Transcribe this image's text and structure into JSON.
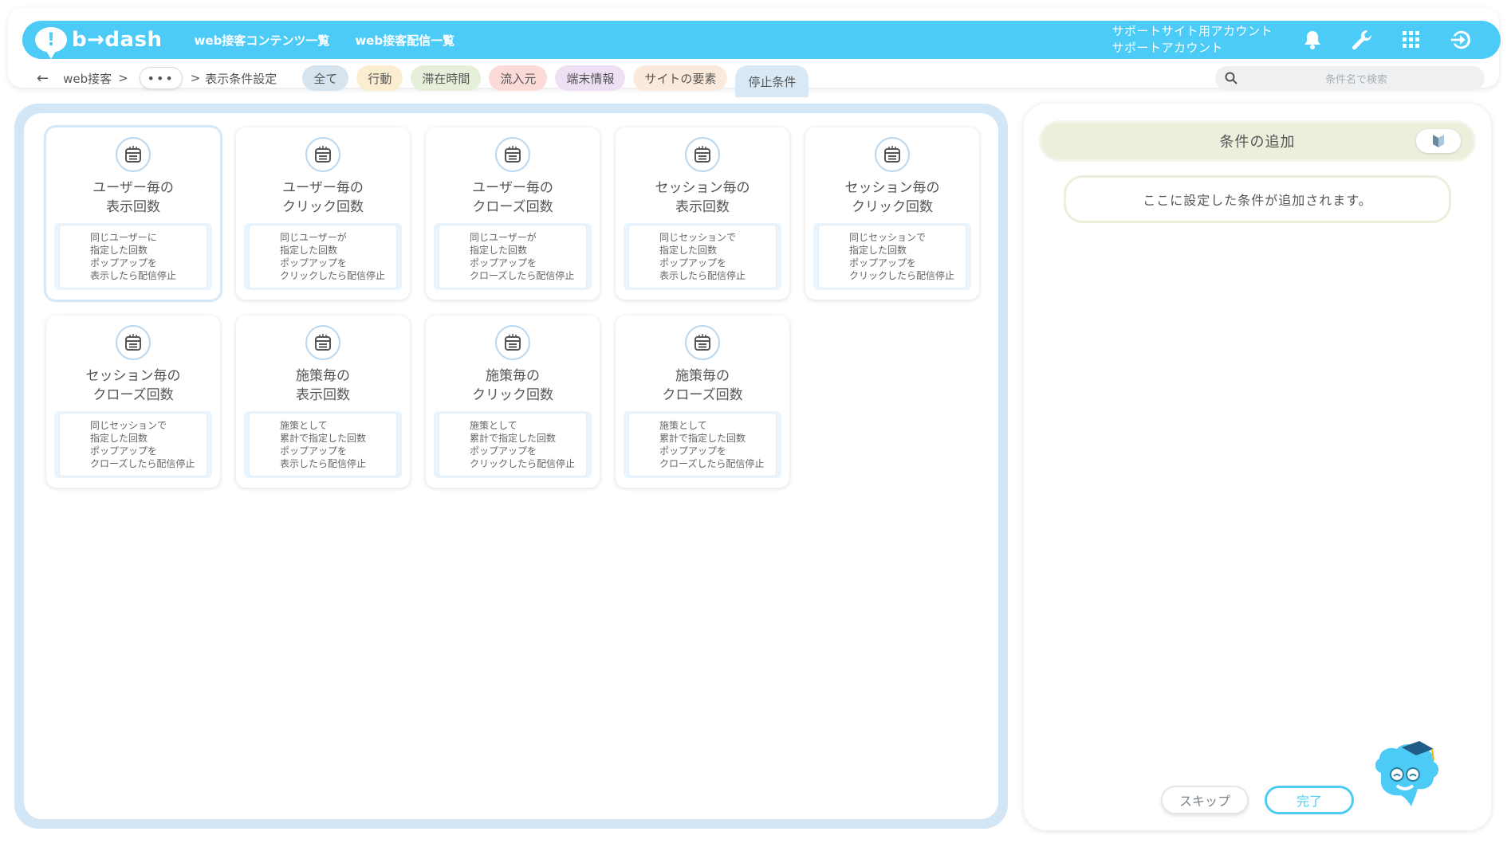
{
  "header": {
    "logo_mark": "!",
    "logo_text": "b→dash",
    "nav": [
      "web接客コンテンツ一覧",
      "web接客配信一覧"
    ],
    "account_line1": "サポートサイト用アカウント",
    "account_line2": "サポートアカウント",
    "icons": [
      "bell-icon",
      "wrench-icon",
      "grid-icon",
      "logout-icon"
    ],
    "brand_color": "#4dcbf7"
  },
  "breadcrumb": {
    "back": "←",
    "root": "web接客",
    "sep": ">",
    "more": "•••",
    "current": "表示条件設定"
  },
  "tabs": [
    {
      "label": "全て",
      "color": "#d6e4ef"
    },
    {
      "label": "行動",
      "color": "#fbeed0"
    },
    {
      "label": "滞在時間",
      "color": "#e5efd9"
    },
    {
      "label": "流入元",
      "color": "#fbdad8"
    },
    {
      "label": "端末情報",
      "color": "#eee0f4"
    },
    {
      "label": "サイトの要素",
      "color": "#fbeadb"
    },
    {
      "label": "停止条件",
      "color": "#d9e8f5",
      "active": true
    }
  ],
  "search": {
    "placeholder": "条件名で検索"
  },
  "cards": [
    {
      "title1": "ユーザー毎の",
      "title2": "表示回数",
      "desc": [
        "同じユーザーに",
        "指定した回数",
        "ポップアップを",
        "表示したら配信停止"
      ],
      "selected": true
    },
    {
      "title1": "ユーザー毎の",
      "title2": "クリック回数",
      "desc": [
        "同じユーザーが",
        "指定した回数",
        "ポップアップを",
        "クリックしたら配信停止"
      ]
    },
    {
      "title1": "ユーザー毎の",
      "title2": "クローズ回数",
      "desc": [
        "同じユーザーが",
        "指定した回数",
        "ポップアップを",
        "クローズしたら配信停止"
      ]
    },
    {
      "title1": "セッション毎の",
      "title2": "表示回数",
      "desc": [
        "同じセッションで",
        "指定した回数",
        "ポップアップを",
        "表示したら配信停止"
      ]
    },
    {
      "title1": "セッション毎の",
      "title2": "クリック回数",
      "desc": [
        "同じセッションで",
        "指定した回数",
        "ポップアップを",
        "クリックしたら配信停止"
      ]
    },
    {
      "title1": "セッション毎の",
      "title2": "クローズ回数",
      "desc": [
        "同じセッションで",
        "指定した回数",
        "ポップアップを",
        "クローズしたら配信停止"
      ]
    },
    {
      "title1": "施策毎の",
      "title2": "表示回数",
      "desc": [
        "施策として",
        "累計で指定した回数",
        "ポップアップを",
        "表示したら配信停止"
      ]
    },
    {
      "title1": "施策毎の",
      "title2": "クリック回数",
      "desc": [
        "施策として",
        "累計で指定した回数",
        "ポップアップを",
        "クリックしたら配信停止"
      ]
    },
    {
      "title1": "施策毎の",
      "title2": "クローズ回数",
      "desc": [
        "施策として",
        "累計で指定した回数",
        "ポップアップを",
        "クローズしたら配信停止"
      ]
    }
  ],
  "right": {
    "title": "条件の追加",
    "placeholder": "ここに設定した条件が追加されます。",
    "skip": "スキップ",
    "done": "完了"
  }
}
